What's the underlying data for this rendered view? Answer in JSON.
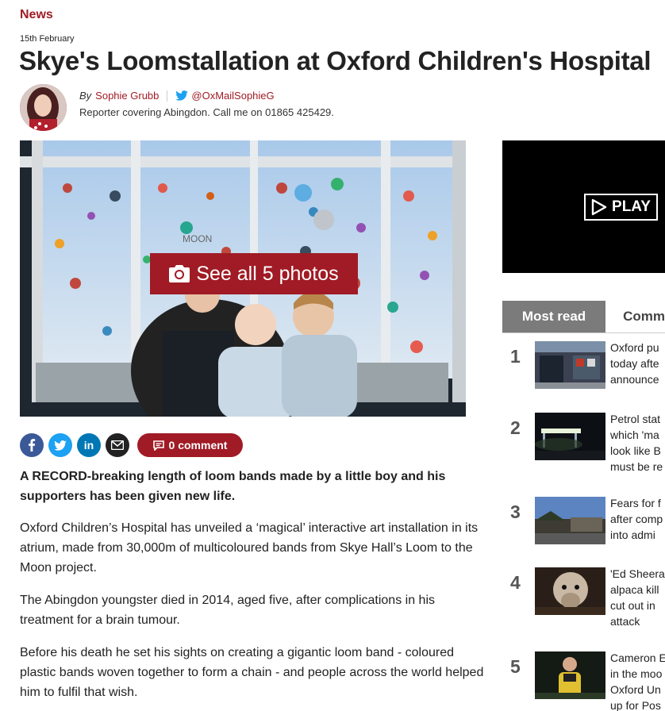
{
  "section": "News",
  "date": "15th February",
  "headline": "Skye's Loomstallation at Oxford Children's Hospital",
  "byline": {
    "by": "By",
    "author": "Sophie Grubb",
    "twitter": "@OxMailSophieG",
    "bio": "Reporter covering Abingdon. Call me on 01865 425429."
  },
  "hero": {
    "photos_button": "See all 5 photos",
    "window_text": "MOON"
  },
  "share": {
    "comment_label": "0 comment",
    "icons": [
      "facebook-icon",
      "twitter-icon",
      "linkedin-icon",
      "email-icon"
    ]
  },
  "article": {
    "lead": "A RECORD-breaking length of loom bands made by a little boy and his supporters has been given new life.",
    "paragraphs": [
      "Oxford Children’s Hospital has unveiled a ‘magical’ interactive art installation in its atrium, made from 30,000m of multicoloured bands from Skye Hall’s Loom to the Moon project.",
      "The Abingdon youngster died in 2014, aged five, after complications in his treatment for a brain tumour.",
      "Before his death he set his sights on creating a gigantic loom band - coloured plastic bands woven together to form a chain - and people across the world helped him to fulfil that wish."
    ]
  },
  "video": {
    "play_label": "PLAY"
  },
  "sidebar": {
    "tab_active": "Most read",
    "tab_other": "Comm",
    "most_read": [
      {
        "num": "1",
        "lines": [
          "Oxford pu",
          "today afte",
          "announce"
        ]
      },
      {
        "num": "2",
        "lines": [
          "Petrol stat",
          "which 'ma",
          "look like B",
          "must be re"
        ]
      },
      {
        "num": "3",
        "lines": [
          "Fears for f",
          "after comp",
          "into admi"
        ]
      },
      {
        "num": "4",
        "lines": [
          "'Ed Sheera",
          "alpaca kill",
          "cut out in",
          "attack"
        ]
      },
      {
        "num": "5",
        "lines": [
          "Cameron E",
          "in the moo",
          "Oxford Un",
          "up for Pos"
        ]
      }
    ]
  },
  "colors": {
    "brand": "#a01b25",
    "facebook": "#3b5998",
    "twitter": "#1da1f2",
    "linkedin": "#0077b5",
    "email": "#222222",
    "tab": "#7b7b7b"
  }
}
